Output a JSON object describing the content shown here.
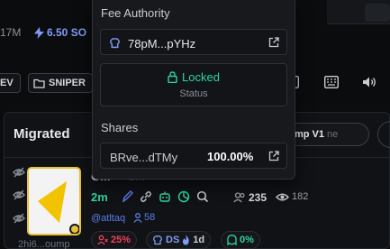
{
  "header": {
    "stat_left": "17M",
    "sol_value": "6.50 SO"
  },
  "toolbar": {
    "chip_left": "EV",
    "chip_sniper": "SNIPER"
  },
  "panel": {
    "title": "Migrated",
    "filter_label": "mp V1",
    "filter_placeholder": "ne"
  },
  "token": {
    "name": "C...",
    "sub": "C...",
    "age": "2m",
    "holders": "235",
    "views": "182",
    "handle": "@atltaq",
    "followers": "58",
    "short_address": "2hi6...oump",
    "top10_pct": "25%",
    "dev_label": "DS",
    "dev_age": "1d",
    "snipers_pct": "0%"
  },
  "popover": {
    "fee_authority_label": "Fee Authority",
    "fee_authority_value": "78pM...pYHz",
    "lock_status": "Locked",
    "lock_caption": "Status",
    "shares_label": "Shares",
    "share_address": "BRve...dTMy",
    "share_percent": "100.00%"
  },
  "colors": {
    "accent_green": "#2dd4a0",
    "accent_blue": "#7f9cf5",
    "accent_red": "#f0415b",
    "avatar_border": "#e7c23a"
  }
}
